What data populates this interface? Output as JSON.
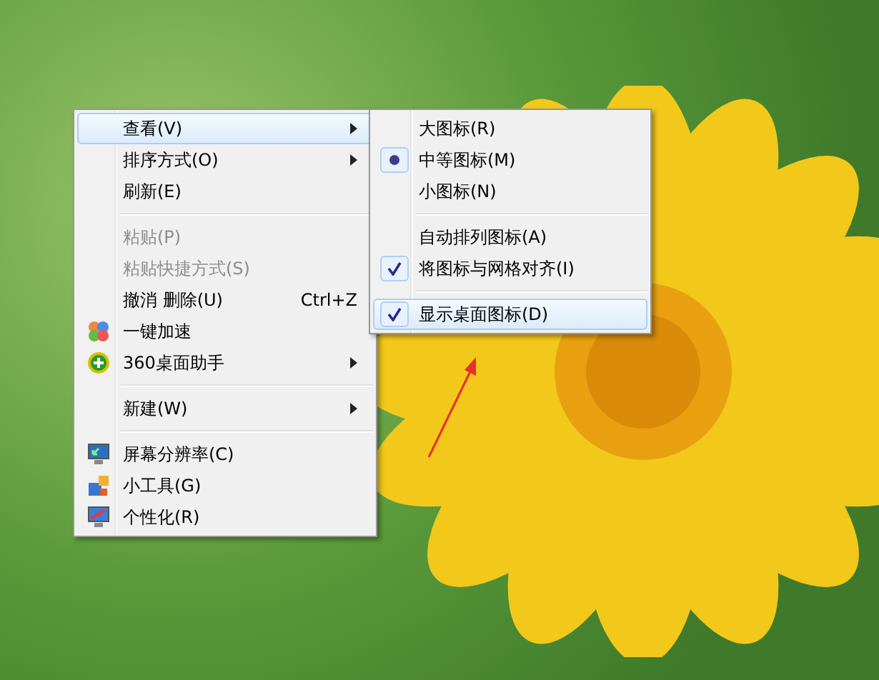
{
  "context_menu": {
    "items": [
      {
        "kind": "item",
        "label": "查看(V)",
        "submenu": true,
        "selected": true,
        "disabled": false
      },
      {
        "kind": "item",
        "label": "排序方式(O)",
        "submenu": true,
        "selected": false,
        "disabled": false
      },
      {
        "kind": "item",
        "label": "刷新(E)",
        "submenu": false,
        "selected": false,
        "disabled": false
      },
      {
        "kind": "separator"
      },
      {
        "kind": "item",
        "label": "粘贴(P)",
        "submenu": false,
        "selected": false,
        "disabled": true
      },
      {
        "kind": "item",
        "label": "粘贴快捷方式(S)",
        "submenu": false,
        "selected": false,
        "disabled": true
      },
      {
        "kind": "item",
        "label": "撤消 删除(U)",
        "shortcut": "Ctrl+Z",
        "submenu": false,
        "selected": false,
        "disabled": false
      },
      {
        "kind": "balls",
        "label": "一键加速",
        "submenu": false,
        "selected": false,
        "disabled": false
      },
      {
        "kind": "plus-badge",
        "label": "360桌面助手",
        "submenu": true,
        "selected": false,
        "disabled": false
      },
      {
        "kind": "separator"
      },
      {
        "kind": "item",
        "label": "新建(W)",
        "submenu": true,
        "selected": false,
        "disabled": false
      },
      {
        "kind": "separator"
      },
      {
        "kind": "monitor",
        "label": "屏幕分辨率(C)",
        "submenu": false,
        "selected": false,
        "disabled": false
      },
      {
        "kind": "gadget",
        "label": "小工具(G)",
        "submenu": false,
        "selected": false,
        "disabled": false
      },
      {
        "kind": "monitor-paint",
        "label": "个性化(R)",
        "submenu": false,
        "selected": false,
        "disabled": false
      }
    ]
  },
  "view_submenu": {
    "items": [
      {
        "kind": "radio",
        "label": "大图标(R)",
        "checked": false,
        "selected": false
      },
      {
        "kind": "radio",
        "label": "中等图标(M)",
        "checked": true,
        "selected": false
      },
      {
        "kind": "radio",
        "label": "小图标(N)",
        "checked": false,
        "selected": false
      },
      {
        "kind": "separator"
      },
      {
        "kind": "check",
        "label": "自动排列图标(A)",
        "checked": false,
        "selected": false
      },
      {
        "kind": "check",
        "label": "将图标与网格对齐(I)",
        "checked": true,
        "selected": false
      },
      {
        "kind": "separator"
      },
      {
        "kind": "check",
        "label": "显示桌面图标(D)",
        "checked": true,
        "selected": true
      }
    ]
  }
}
